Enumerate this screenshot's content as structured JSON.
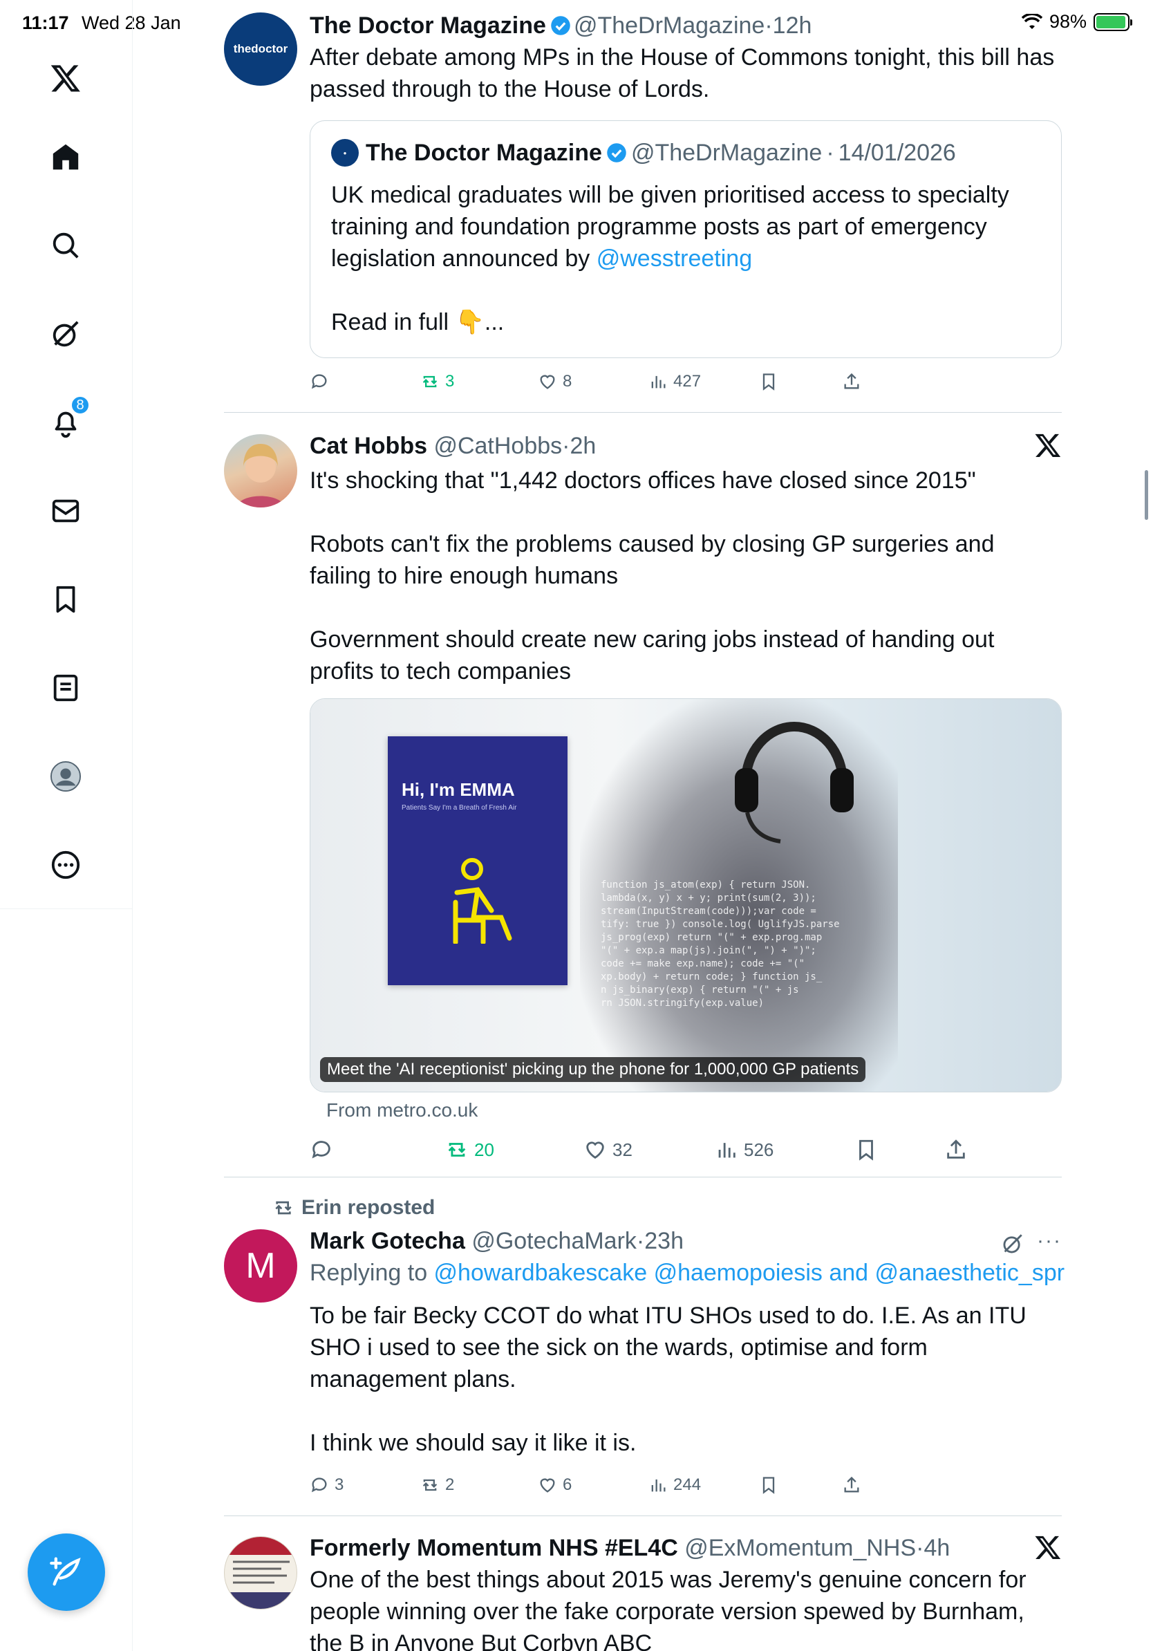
{
  "status_bar": {
    "time": "11:17",
    "date": "Wed 28 Jan",
    "battery": "98%"
  },
  "sidebar": {
    "items": [
      {
        "name": "home",
        "icon": "home-icon"
      },
      {
        "name": "explore",
        "icon": "search-icon"
      },
      {
        "name": "grok",
        "icon": "grok-icon"
      },
      {
        "name": "notifications",
        "icon": "bell-icon",
        "badge": "8"
      },
      {
        "name": "messages",
        "icon": "mail-icon"
      },
      {
        "name": "bookmarks",
        "icon": "bookmark-icon"
      },
      {
        "name": "lists",
        "icon": "list-icon"
      },
      {
        "name": "profile",
        "icon": "avatar-icon"
      },
      {
        "name": "more",
        "icon": "more-icon"
      }
    ]
  },
  "tweets": [
    {
      "name": "The Doctor Magazine",
      "handle": "@TheDrMagazine",
      "time": "12h",
      "avatar_text": "thedoctor",
      "text": "After debate among MPs in the House of Commons tonight, this bill has passed through to the House of Lords.",
      "quote": {
        "name": "The Doctor Magazine",
        "handle": "@TheDrMagazine",
        "date": "14/01/2026",
        "text": "UK medical graduates will be given prioritised access to specialty training and foundation programme posts as part of emergency legislation announced by ",
        "mention": "@wesstreeting",
        "read_more": "Read in full 👇..."
      },
      "stats": {
        "replies": "",
        "reposts": "3",
        "likes": "8",
        "views": "427"
      }
    },
    {
      "name": "Cat Hobbs",
      "handle": "@CatHobbs",
      "time": "2h",
      "text_1": "It's shocking that \"1,442 doctors offices have closed since 2015\"",
      "text_2": "Robots can't fix the problems caused by closing GP surgeries and failing to hire enough humans",
      "text_3": "Government should create new caring jobs instead of handing out profits to tech companies",
      "card": {
        "poster_title": "Hi, I'm EMMA",
        "poster_subtitle": "Patients Say I'm a Breath of Fresh Air",
        "caption": "Meet the 'AI receptionist' picking up the phone for 1,000,000 GP patients",
        "source": "From metro.co.uk"
      },
      "stats": {
        "replies": "",
        "reposts": "20",
        "likes": "32",
        "views": "526"
      }
    },
    {
      "reposted_by": "Erin reposted",
      "name": "Mark Gotecha",
      "handle": "@GotechaMark",
      "time": "23h",
      "avatar_letter": "M",
      "replying_prefix": "Replying to ",
      "replying_to": "@howardbakescake @haemopoiesis",
      "replying_and": " and ",
      "replying_last": "@anaesthetic_spr",
      "text_1": "To be fair Becky CCOT do what ITU SHOs used to do. I.E. As an ITU SHO i used to see the sick on the wards, optimise and form management plans.",
      "text_2": "I think we should say it like it is.",
      "stats": {
        "replies": "3",
        "reposts": "2",
        "likes": "6",
        "views": "244"
      }
    },
    {
      "name": "Formerly Momentum NHS #EL4C",
      "handle": "@ExMomentum_NHS",
      "time": "4h",
      "text": "One of the best things about 2015 was Jeremy's genuine concern for people winning over the fake corporate version spewed by Burnham, the B in Anyone But Corbyn ABC"
    }
  ],
  "colors": {
    "accent": "#1d9bf0",
    "repost_green": "#00ba7c",
    "text_secondary": "#536471",
    "divider": "#cfd9de"
  }
}
